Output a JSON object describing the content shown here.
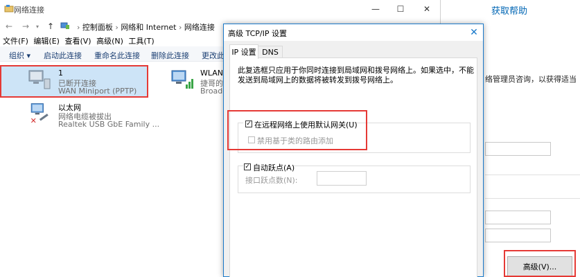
{
  "settings": {
    "help_link": "获取帮助",
    "partial_text": "络管理员咨询，以获得适当",
    "advanced_button": "高级(V)..."
  },
  "network_window": {
    "title": "网络连接",
    "breadcrumb": [
      "控制面板",
      "网络和 Internet",
      "网络连接"
    ],
    "breadcrumb_separator": "›",
    "menu": [
      "文件(F)",
      "编辑(E)",
      "查看(V)",
      "高级(N)",
      "工具(T)"
    ],
    "toolbar": [
      "组织 ▾",
      "启动此连接",
      "重命名此连接",
      "删除此连接",
      "更改此"
    ],
    "connections": [
      {
        "name": "1",
        "status": "已断开连接",
        "device": "WAN Miniport (PPTP)"
      },
      {
        "name": "WLAN",
        "status": "捷哥的",
        "device": "Broadc"
      },
      {
        "name": "以太网",
        "status": "网络电缆被拔出",
        "device": "Realtek USB GbE Family ..."
      }
    ]
  },
  "dialog": {
    "title": "高级 TCP/IP 设置",
    "close_glyph": "✕",
    "tabs": [
      "IP 设置",
      "DNS"
    ],
    "description_lines": [
      "此复选框只应用于你同时连接到局域网和拨号网络上。如果选中，不能",
      "发送到局域网上的数据将被转发到拨号网络上。"
    ],
    "use_default_gateway": {
      "label": "在远程网络上使用默认网关(U)",
      "checked": true
    },
    "disable_class_routes": {
      "label": "禁用基于类的路由添加",
      "checked": false,
      "disabled": true
    },
    "auto_metric": {
      "label": "自动跃点(A)",
      "checked": true
    },
    "interface_metric": {
      "label": "接口跃点数(N):",
      "value": ""
    }
  },
  "colors": {
    "accent": "#1979ca",
    "highlight": "#e53935",
    "selection": "#cde4f7"
  }
}
